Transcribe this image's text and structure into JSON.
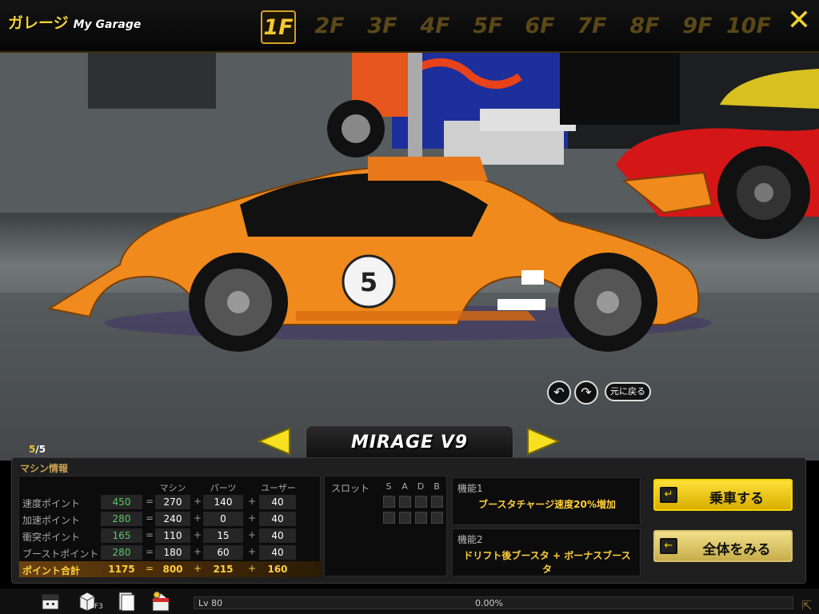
{
  "header": {
    "title": "ガレージ",
    "title_sub": "My Garage",
    "floors": [
      "1F",
      "2F",
      "3F",
      "4F",
      "5F",
      "6F",
      "7F",
      "8F",
      "9F",
      "10F"
    ],
    "active_floor": "1F"
  },
  "scene": {
    "car_number": "5",
    "rotate_left_icon": "rotate-left-icon",
    "rotate_right_icon": "rotate-right-icon",
    "reset_label": "元に戻る"
  },
  "selector": {
    "current": "5",
    "total": "5",
    "car_name": "MIRAGE V9"
  },
  "info": {
    "title": "マシン情報",
    "headers": [
      "マシン",
      "パーツ",
      "ユーザー"
    ],
    "rows": [
      {
        "label": "速度ポイント",
        "total": "450",
        "machine": "270",
        "parts": "140",
        "user": "40"
      },
      {
        "label": "加速ポイント",
        "total": "280",
        "machine": "240",
        "parts": "0",
        "user": "40"
      },
      {
        "label": "衝突ポイント",
        "total": "165",
        "machine": "110",
        "parts": "15",
        "user": "40"
      },
      {
        "label": "ブーストポイント",
        "total": "280",
        "machine": "180",
        "parts": "60",
        "user": "40"
      }
    ],
    "sum": {
      "label": "ポイント合計",
      "total": "1175",
      "machine": "800",
      "parts": "215",
      "user": "160"
    },
    "op_eq": "=",
    "op_plus": "+"
  },
  "slots": {
    "label": "スロット",
    "columns": [
      "S",
      "A",
      "D",
      "B"
    ]
  },
  "functions": [
    {
      "title": "機能1",
      "desc": "ブースタチャージ速度20%増加"
    },
    {
      "title": "機能2",
      "desc": "ドリフト後ブースタ + ボーナスブースタ"
    }
  ],
  "buttons": {
    "ride": "乗車する",
    "view_all": "全体をみる"
  },
  "footer": {
    "level": "Lv 80",
    "exp": "0.00%",
    "f3_label": "F3"
  },
  "colors": {
    "accent": "#f4d400",
    "car_body": "#f08a1c",
    "stat_green": "#5ec46c",
    "total_gold": "#ffcf40"
  }
}
